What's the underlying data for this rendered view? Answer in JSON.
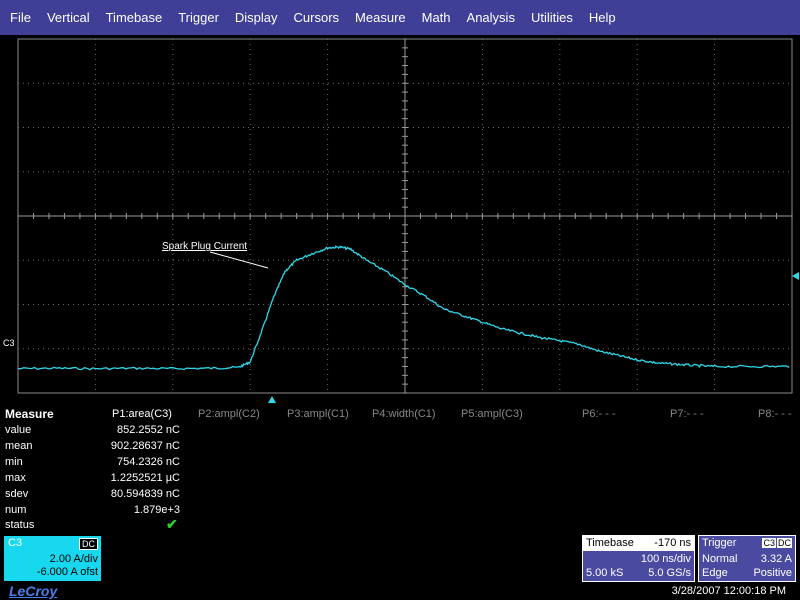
{
  "menu": [
    "File",
    "Vertical",
    "Timebase",
    "Trigger",
    "Display",
    "Cursors",
    "Measure",
    "Math",
    "Analysis",
    "Utilities",
    "Help"
  ],
  "channel_marker": "C3",
  "trace_label": "Spark Plug Current",
  "trace_color": "#2fd8e8",
  "trace_points": [
    [
      0,
      0.55
    ],
    [
      1,
      0.56
    ],
    [
      2,
      0.55
    ],
    [
      3,
      0.56
    ],
    [
      4,
      0.55
    ],
    [
      5,
      0.56
    ],
    [
      5.7,
      0.58
    ],
    [
      6,
      0.7
    ],
    [
      6.3,
      1.4
    ],
    [
      6.6,
      2.15
    ],
    [
      6.9,
      2.75
    ],
    [
      7.2,
      3.0
    ],
    [
      7.6,
      3.15
    ],
    [
      8.0,
      3.28
    ],
    [
      8.3,
      3.3
    ],
    [
      8.6,
      3.25
    ],
    [
      9,
      3.0
    ],
    [
      9.5,
      2.75
    ],
    [
      10,
      2.45
    ],
    [
      10.5,
      2.2
    ],
    [
      11,
      1.9
    ],
    [
      11.5,
      1.75
    ],
    [
      12,
      1.6
    ],
    [
      12.5,
      1.45
    ],
    [
      13,
      1.35
    ],
    [
      13.5,
      1.25
    ],
    [
      14,
      1.18
    ],
    [
      14.5,
      1.1
    ],
    [
      15,
      0.95
    ],
    [
      15.5,
      0.85
    ],
    [
      16,
      0.75
    ],
    [
      16.5,
      0.68
    ],
    [
      17,
      0.65
    ],
    [
      17.5,
      0.62
    ],
    [
      18,
      0.6
    ],
    [
      19,
      0.6
    ],
    [
      20,
      0.6
    ]
  ],
  "measure": {
    "title": "Measure",
    "params": [
      "P1:area(C3)",
      "P2:ampl(C2)",
      "P3:ampl(C1)",
      "P4:width(C1)",
      "P5:ampl(C3)",
      "P6:- - -",
      "P7:- - -",
      "P8:- - -"
    ],
    "rows": [
      {
        "label": "value",
        "value": "852.2552 nC"
      },
      {
        "label": "mean",
        "value": "902.28637 nC"
      },
      {
        "label": "min",
        "value": "754.2326 nC"
      },
      {
        "label": "max",
        "value": "1.2252521 µC"
      },
      {
        "label": "sdev",
        "value": "80.594839 nC"
      },
      {
        "label": "num",
        "value": "1.879e+3"
      },
      {
        "label": "status",
        "value": ""
      }
    ]
  },
  "channel_box": {
    "name": "C3",
    "coupling": "DC",
    "vdiv": "2.00 A/div",
    "offset": "-6.000 A ofst"
  },
  "timebase": {
    "title": "Timebase",
    "offset": "-170 ns",
    "per_div": "100 ns/div",
    "samples": "5.00 kS",
    "rate": "5.0 GS/s"
  },
  "trigger": {
    "title": "Trigger",
    "source": "C3",
    "coupling": "DC",
    "mode": "Normal",
    "level": "3.32 A",
    "type": "Edge",
    "slope": "Positive"
  },
  "logo": "LeCroy",
  "timestamp": "3/28/2007 12:00:18 PM"
}
